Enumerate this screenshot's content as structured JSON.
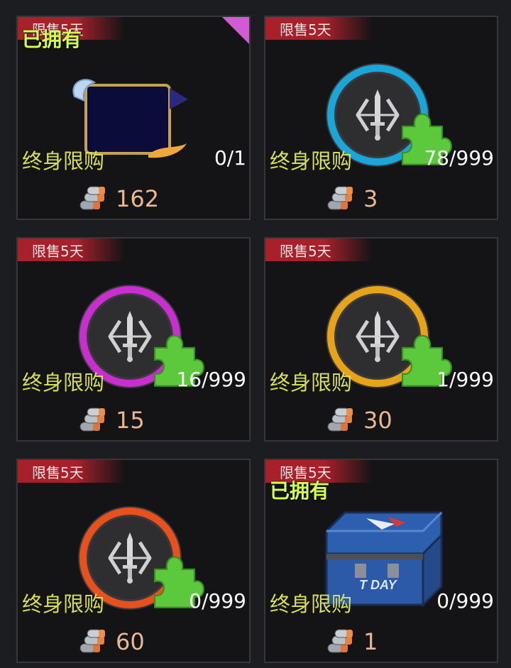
{
  "cards": [
    {
      "tag": "限售5天",
      "owned": "已拥有",
      "limit": "终身限购",
      "count": "0/1",
      "price": "162",
      "item": "avatar-frame",
      "ring_color": ""
    },
    {
      "tag": "限售5天",
      "owned": "",
      "limit": "终身限购",
      "count": "78/999",
      "price": "3",
      "item": "skill-fragment",
      "ring_color": "#1aa6d8"
    },
    {
      "tag": "限售5天",
      "owned": "",
      "limit": "终身限购",
      "count": "16/999",
      "price": "15",
      "item": "skill-fragment",
      "ring_color": "#c92fd0"
    },
    {
      "tag": "限售5天",
      "owned": "",
      "limit": "终身限购",
      "count": "1/999",
      "price": "30",
      "item": "skill-fragment",
      "ring_color": "#e8a418"
    },
    {
      "tag": "限售5天",
      "owned": "",
      "limit": "终身限购",
      "count": "0/999",
      "price": "60",
      "item": "skill-fragment",
      "ring_color": "#e8501c"
    },
    {
      "tag": "限售5天",
      "owned": "已拥有",
      "limit": "终身限购",
      "count": "0/999",
      "price": "1",
      "item": "treasure-chest",
      "ring_color": ""
    }
  ],
  "chest_text": "T DAY",
  "currency_icon": "silver-bullets-icon",
  "colors": {
    "ribbon": "#a8202a",
    "owned_text": "#d4ff4a",
    "limit_text": "#d8df56",
    "price_text": "#e9b790",
    "puzzle": "#5cc83c",
    "corner": "#d25ad2"
  }
}
